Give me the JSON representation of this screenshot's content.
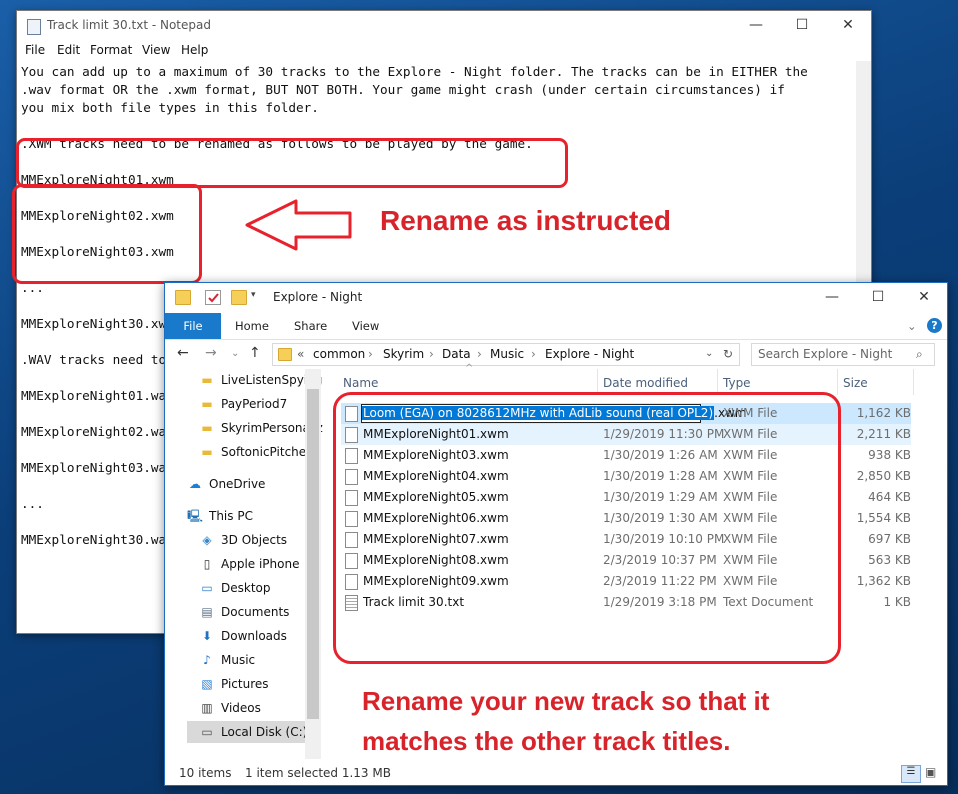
{
  "notepad": {
    "title": "Track limit 30.txt - Notepad",
    "controls": {
      "minimize": "—",
      "maximize": "☐",
      "close": "✕"
    },
    "menu": [
      "File",
      "Edit",
      "Format",
      "View",
      "Help"
    ],
    "lines": [
      "You can add up to a maximum of 30 tracks to the Explore - Night folder. The tracks can be in EITHER the",
      ".wav format OR the .xwm format, BUT NOT BOTH. Your game might crash (under certain circumstances) if",
      "you mix both file types in this folder.",
      "",
      ".XWM tracks need to be renamed as follows to be played by the game.",
      "",
      "MMExploreNight01.xwm",
      "",
      "MMExploreNight02.xwm",
      "",
      "MMExploreNight03.xwm",
      "",
      "...",
      "",
      "MMExploreNight30.xwm",
      "",
      ".WAV tracks need to be renamed as follows to be played by the game.",
      "",
      "MMExploreNight01.wav",
      "",
      "MMExploreNight02.wav",
      "",
      "MMExploreNight03.wav",
      "",
      "...",
      "",
      "MMExploreNight30.wav"
    ]
  },
  "explorer": {
    "title": "Explore - Night",
    "controls": {
      "minimize": "—",
      "maximize": "☐",
      "close": "✕"
    },
    "ribbon_tabs": [
      "File",
      "Home",
      "Share",
      "View"
    ],
    "breadcrumb": [
      "«",
      "common",
      "Skyrim",
      "Data",
      "Music",
      "Explore - Night"
    ],
    "search_placeholder": "Search Explore - Night",
    "nav_items": [
      {
        "label": "LiveListenSpying",
        "icon": "folder-icon"
      },
      {
        "label": "PayPeriod7",
        "icon": "folder-icon"
      },
      {
        "label": "SkyrimPersonaliz",
        "icon": "folder-icon"
      },
      {
        "label": "SoftonicPitches",
        "icon": "folder-icon"
      },
      {
        "label": "OneDrive",
        "icon": "cloud-icon"
      },
      {
        "label": "This PC",
        "icon": "computer-icon"
      },
      {
        "label": "3D Objects",
        "icon": "cube-icon"
      },
      {
        "label": "Apple iPhone",
        "icon": "phone-icon"
      },
      {
        "label": "Desktop",
        "icon": "desktop-icon"
      },
      {
        "label": "Documents",
        "icon": "document-icon"
      },
      {
        "label": "Downloads",
        "icon": "download-icon"
      },
      {
        "label": "Music",
        "icon": "music-icon"
      },
      {
        "label": "Pictures",
        "icon": "picture-icon"
      },
      {
        "label": "Videos",
        "icon": "video-icon"
      },
      {
        "label": "Local Disk (C:)",
        "icon": "drive-icon"
      }
    ],
    "columns": [
      "Name",
      "Date modified",
      "Type",
      "Size"
    ],
    "rename": {
      "selected": "Loom (EGA) on 8028612MHz with AdLib sound (real OPL2)",
      "ext": ".xwm",
      "type": "XWM File",
      "size": "1,162 KB"
    },
    "files": [
      {
        "name": "MMExploreNight01.xwm",
        "date": "1/29/2019 11:30 PM",
        "type": "XWM File",
        "size": "2,211 KB"
      },
      {
        "name": "MMExploreNight03.xwm",
        "date": "1/30/2019 1:26 AM",
        "type": "XWM File",
        "size": "938 KB"
      },
      {
        "name": "MMExploreNight04.xwm",
        "date": "1/30/2019 1:28 AM",
        "type": "XWM File",
        "size": "2,850 KB"
      },
      {
        "name": "MMExploreNight05.xwm",
        "date": "1/30/2019 1:29 AM",
        "type": "XWM File",
        "size": "464 KB"
      },
      {
        "name": "MMExploreNight06.xwm",
        "date": "1/30/2019 1:30 AM",
        "type": "XWM File",
        "size": "1,554 KB"
      },
      {
        "name": "MMExploreNight07.xwm",
        "date": "1/30/2019 10:10 PM",
        "type": "XWM File",
        "size": "697 KB"
      },
      {
        "name": "MMExploreNight08.xwm",
        "date": "2/3/2019 10:37 PM",
        "type": "XWM File",
        "size": "563 KB"
      },
      {
        "name": "MMExploreNight09.xwm",
        "date": "2/3/2019 11:22 PM",
        "type": "XWM File",
        "size": "1,362 KB"
      },
      {
        "name": "Track limit 30.txt",
        "date": "1/29/2019 3:18 PM",
        "type": "Text Document",
        "size": "1 KB"
      }
    ],
    "status": {
      "count": "10 items",
      "selection": "1 item selected  1.13 MB"
    }
  },
  "annotations": {
    "top": "Rename as instructed",
    "bottom_line1": "Rename your new track so that it",
    "bottom_line2": "matches the other track titles."
  },
  "colors": {
    "annotation_red": "#e8222c",
    "selection_blue": "#cce8ff",
    "file_tab_blue": "#1979ca"
  }
}
